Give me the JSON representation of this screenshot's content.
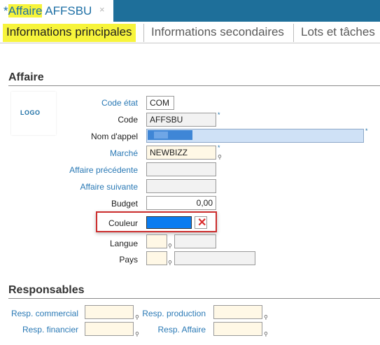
{
  "document_tab": {
    "modified_marker": "*",
    "title_prefix": "Affaire",
    "title_code": "AFFSBU",
    "close_glyph": "×"
  },
  "section_tabs": [
    {
      "label": "Informations principales",
      "active": true
    },
    {
      "label": "Informations secondaires",
      "active": false
    },
    {
      "label": "Lots et tâches",
      "active": false
    }
  ],
  "affaire_section": {
    "title": "Affaire",
    "logo_text": "LOGO",
    "fields": {
      "code_etat": {
        "label": "Code état",
        "value": "COM"
      },
      "code": {
        "label": "Code",
        "value": "AFFSBU",
        "required": "*"
      },
      "nom_appel": {
        "label": "Nom d'appel",
        "value": "",
        "required": "*"
      },
      "marche": {
        "label": "Marché",
        "value": "NEWBIZZ",
        "required": "*"
      },
      "affaire_precedente": {
        "label": "Affaire précédente",
        "value": ""
      },
      "affaire_suivante": {
        "label": "Affaire suivante",
        "value": ""
      },
      "budget": {
        "label": "Budget",
        "value": "0,00"
      },
      "couleur": {
        "label": "Couleur",
        "value_color": "#0a7cf0",
        "clear_glyph": "✕"
      },
      "langue": {
        "label": "Langue",
        "value": ""
      },
      "pays": {
        "label": "Pays",
        "value": ""
      }
    }
  },
  "responsables_section": {
    "title": "Responsables",
    "fields": {
      "resp_commercial": {
        "label": "Resp. commercial",
        "value": ""
      },
      "resp_production": {
        "label": "Resp. production",
        "value": ""
      },
      "resp_financier": {
        "label": "Resp. financier",
        "value": ""
      },
      "resp_affaire": {
        "label": "Resp. Affaire",
        "value": ""
      }
    }
  },
  "colors": {
    "header_blue": "#1e6f9a",
    "highlight_yellow": "#f7f43b",
    "label_blue": "#2a79b5",
    "highlight_red": "#cc2d2d"
  },
  "icons": {
    "lookup_pin": "lookup-pin-icon"
  }
}
